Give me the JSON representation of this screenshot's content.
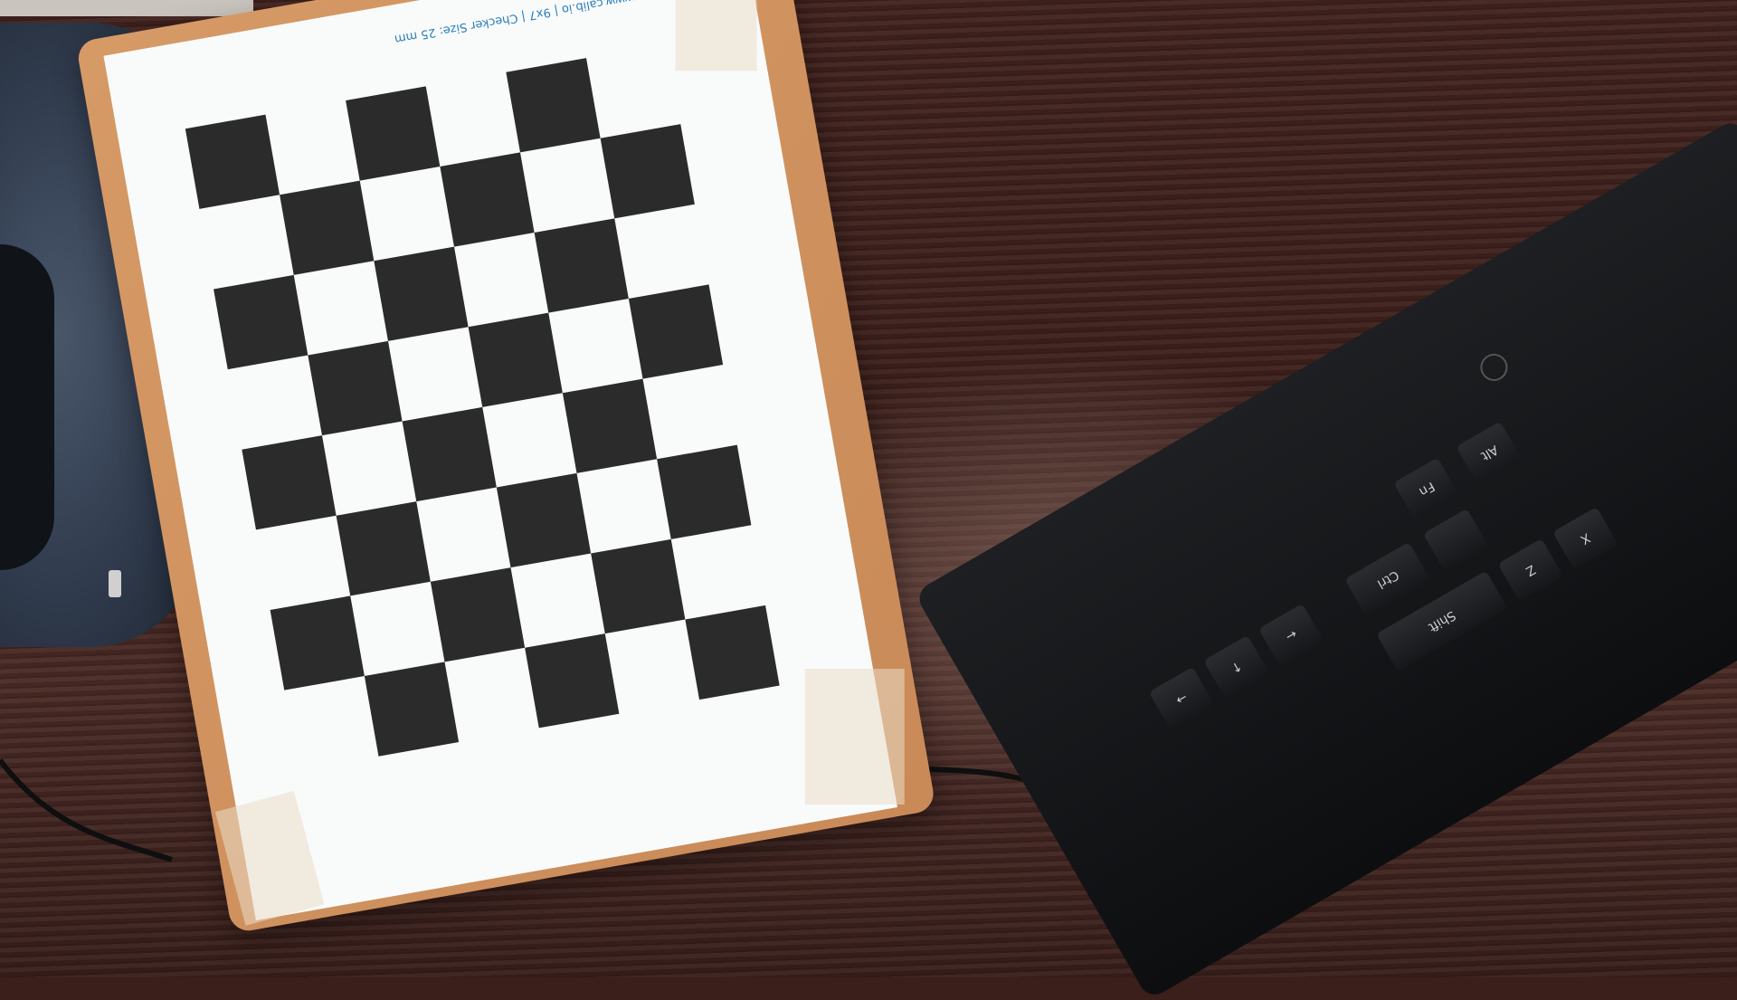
{
  "image": {
    "description_text": {
      "paper_caption": "www.calib.io | 9x7 | Checker Size: 25 mm"
    },
    "checkerboard": {
      "columns": 6,
      "rows": 8,
      "colors": {
        "dark": "#2b2b2b",
        "light": "#f9fbfb"
      }
    },
    "keyboard": {
      "visible_keys": [
        "Alt",
        "Fn",
        "Ctrl",
        "Shift",
        "←",
        "↑",
        "→",
        "Z",
        "X"
      ]
    }
  }
}
